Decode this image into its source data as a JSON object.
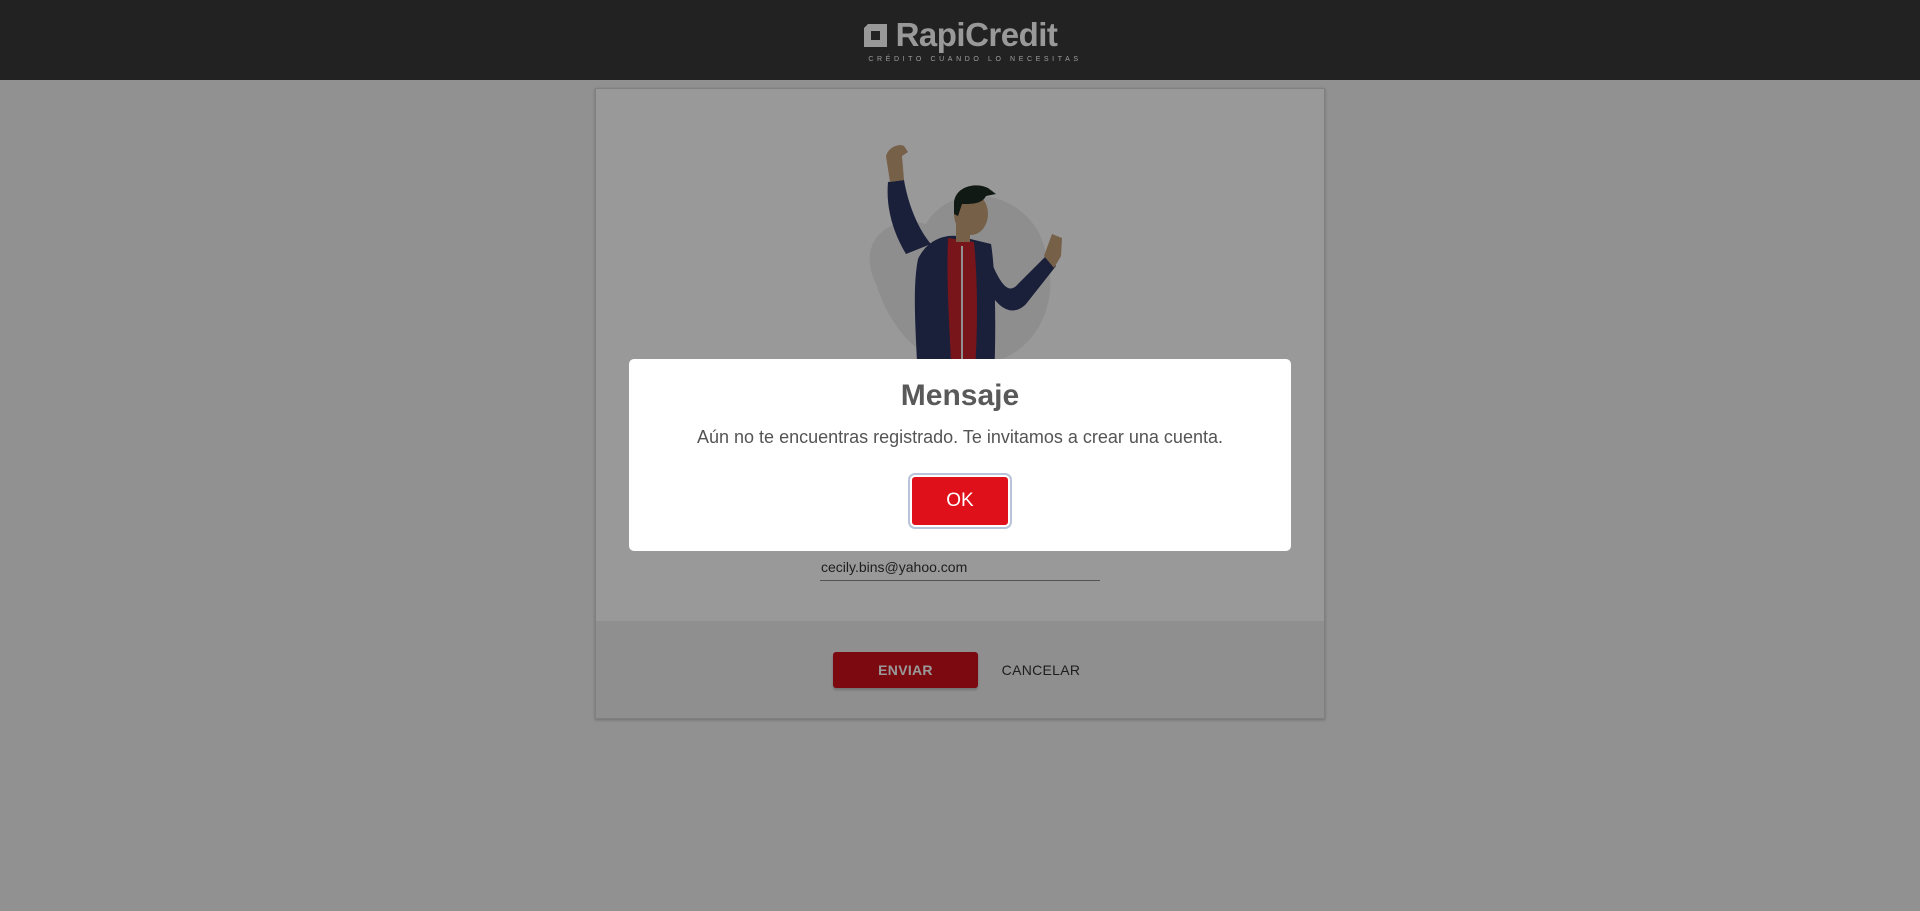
{
  "header": {
    "logo_name": "RapiCredit",
    "logo_tagline": "CRÉDITO CUANDO LO NECESITAS"
  },
  "form": {
    "email_value": "cecily.bins@yahoo.com",
    "submit_label": "ENVIAR",
    "cancel_label": "CANCELAR"
  },
  "modal": {
    "title": "Mensaje",
    "message": "Aún no te encuentras registrado. Te invitamos a crear una cuenta.",
    "ok_label": "OK"
  },
  "colors": {
    "brand_red": "#d0101b",
    "header_bg": "#3a3a3a"
  }
}
